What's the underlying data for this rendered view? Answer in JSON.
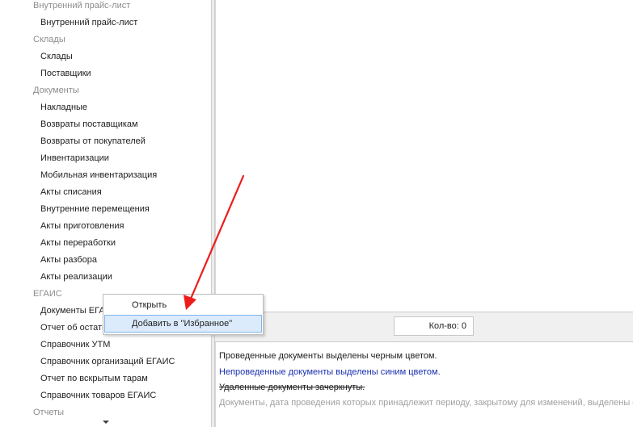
{
  "sidebar": {
    "groups": [
      {
        "label": "Внутренний прайс-лист",
        "items": [
          "Внутренний прайс-лист"
        ]
      },
      {
        "label": "Склады",
        "items": [
          "Склады",
          "Поставщики"
        ]
      },
      {
        "label": "Документы",
        "items": [
          "Накладные",
          "Возвраты поставщикам",
          "Возвраты от покупателей",
          "Инвентаризации",
          "Мобильная инвентаризация",
          "Акты списания",
          "Внутренние перемещения",
          "Акты приготовления",
          "Акты переработки",
          "Акты разбора",
          "Акты реализации"
        ]
      },
      {
        "label": "ЕГАИС",
        "items": [
          "Документы ЕГАИС",
          "Отчет об остатках",
          "Справочник УТМ",
          "Справочник организаций ЕГАИС",
          "Отчет по вскрытым тарам",
          "Справочник товаров ЕГАИС"
        ]
      },
      {
        "label": "Отчеты",
        "items": []
      }
    ],
    "scroll_icon": "triangle-down"
  },
  "status": {
    "count_label": "Кол-во: 0"
  },
  "legend": {
    "black": "Проведенные документы выделены черным цветом.",
    "blue": "Непроведенные документы выделены синим цветом.",
    "deleted": "Удаленные документы зачеркнуты.",
    "closed": "Документы, дата проведения которых принадлежит периоду, закрытому для изменений, выделены серым цветом."
  },
  "context_menu": {
    "open": "Открыть",
    "add_favorite": "Добавить в \"Избранное\""
  },
  "colors": {
    "annotation_arrow": "#ee1c1c",
    "highlight": "#dcebfc",
    "unposted_text": "#1a2fb0"
  }
}
